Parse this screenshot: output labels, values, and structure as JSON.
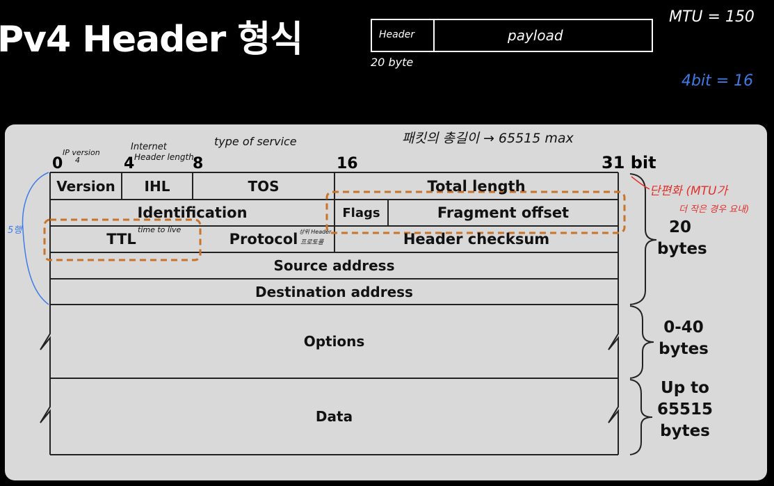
{
  "title": "Pv4 Header 형식",
  "packet": {
    "header_label": "Header",
    "payload_label": "payload",
    "size_note": "20 byte"
  },
  "notes": {
    "mtu": "MTU = 150",
    "bit": "4bit = 16"
  },
  "header_notes": {
    "packet_length": "패킷의 총길이 → 65515 max",
    "ip_version": "IP version",
    "ip_version_val": "4",
    "internet": "Internet",
    "header_len": "Header length",
    "type_of_service": "type of service",
    "rows": "5행",
    "ttl": "time to live",
    "protocol_a": "상위 Header",
    "protocol_b": "프로토콜",
    "fragment_a": "단편화 (MTU가",
    "fragment_b": "더 작은 경우 요내)"
  },
  "bit_positions": [
    "0",
    "4",
    "8",
    "16",
    "31 bit"
  ],
  "fields": {
    "version": "Version",
    "ihl": "IHL",
    "tos": "TOS",
    "total_length": "Total length",
    "identification": "Identification",
    "flags": "Flags",
    "fragment_offset": "Fragment offset",
    "ttl": "TTL",
    "protocol": "Protocol",
    "header_checksum": "Header checksum",
    "source": "Source address",
    "destination": "Destination address",
    "options": "Options",
    "data": "Data"
  },
  "size_labels": {
    "header": "20\nbytes",
    "options": "0-40\nbytes",
    "data": "Up to\n65515\nbytes"
  },
  "colors": {
    "annotation_red": "#e0312b",
    "annotation_blue": "#3d7be6",
    "highlight_orange": "#c8742a"
  }
}
